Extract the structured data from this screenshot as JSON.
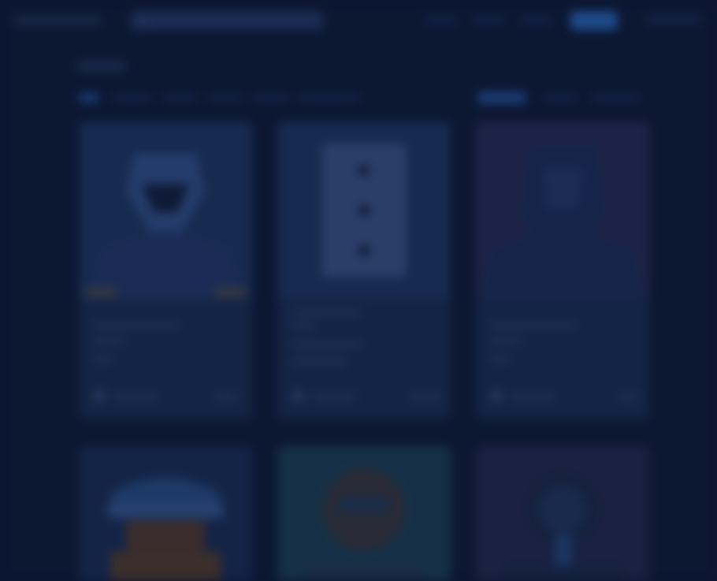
{
  "colors": {
    "background": "#0c1732",
    "card": "#13213f",
    "card_image": "#172a4f",
    "accent": "#1e4a8a",
    "placeholder": "#23345a"
  },
  "header": {
    "logo_text": "",
    "search_placeholder": "",
    "cta_label": ""
  },
  "page": {
    "heading": "",
    "filters": [
      "",
      "",
      "",
      "",
      "",
      ""
    ],
    "sort_options": [
      "",
      "",
      ""
    ]
  },
  "cards": [
    {
      "title": "",
      "subtitle": "",
      "meta": "",
      "author": "",
      "price": "",
      "icon": "skull-illustration-icon"
    },
    {
      "title": "",
      "subtitle": "",
      "meta": "",
      "author": "",
      "price": "",
      "icon": "playing-card-illustration-icon"
    },
    {
      "title": "",
      "subtitle": "",
      "meta": "",
      "author": "",
      "price": "",
      "icon": "hooded-figure-illustration-icon"
    }
  ],
  "cards_row2": [
    {
      "icon": "helmet-illustration-icon"
    },
    {
      "icon": "character-illustration-icon"
    },
    {
      "icon": "portrait-illustration-icon"
    }
  ]
}
